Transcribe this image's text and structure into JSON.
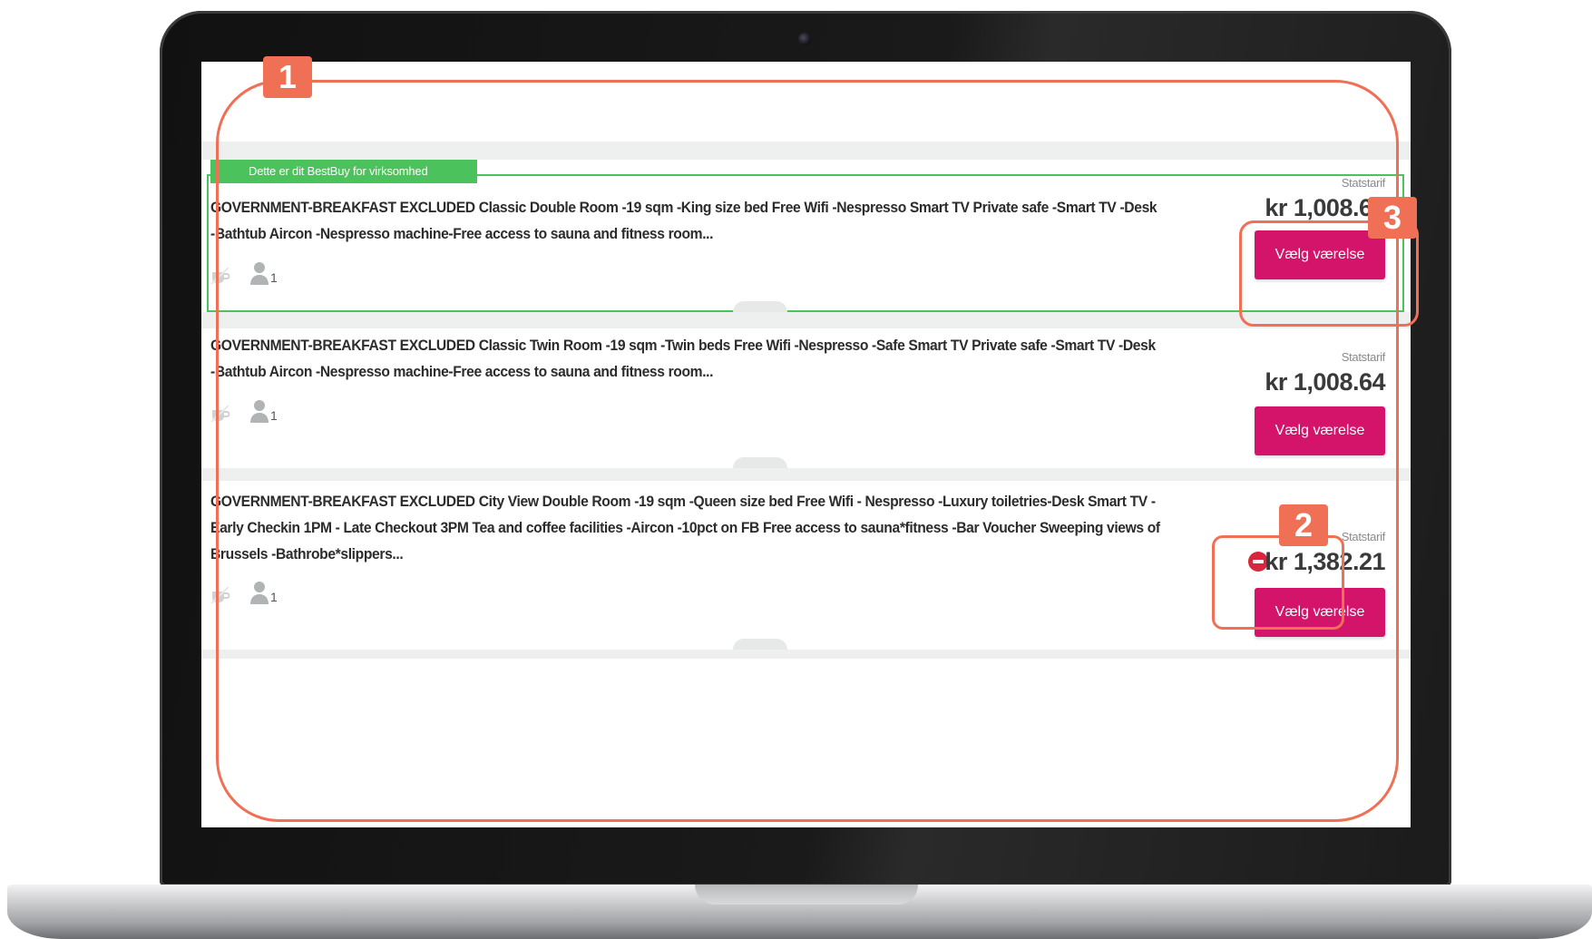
{
  "best_banner": "Dette er dit BestBuy for virksomhed",
  "rooms": [
    {
      "description": "GOVERNMENT-BREAKFAST EXCLUDED Classic Double Room -19 sqm -King size bed Free Wifi -Nespresso Smart TV Private safe -Smart TV -Desk -Bathtub Aircon -Nespresso machine-Free access to sauna and fitness room...",
      "occupancy": "1",
      "rate_label": "Statstarif",
      "price": "kr 1,008.64",
      "button_label": "Vælg værelse"
    },
    {
      "description": "GOVERNMENT-BREAKFAST EXCLUDED Classic Twin Room -19 sqm -Twin beds Free Wifi -Nespresso -Safe Smart TV Private safe -Smart TV -Desk -Bathtub Aircon -Nespresso machine-Free access to sauna and fitness room...",
      "occupancy": "1",
      "rate_label": "Statstarif",
      "price": "kr 1,008.64",
      "button_label": "Vælg værelse"
    },
    {
      "description": "GOVERNMENT-BREAKFAST EXCLUDED City View Double Room -19 sqm -Queen size bed Free Wifi - Nespresso -Luxury toiletries-Desk Smart TV -Early Checkin 1PM - Late Checkout 3PM Tea and coffee facilities -Aircon -10pct on FB Free access to sauna*fitness -Bar Voucher Sweeping views of Brussels -Bathrobe*slippers...",
      "occupancy": "1",
      "rate_label": "Statstarif",
      "price": "kr 1,382.21",
      "button_label": "Vælg værelse"
    }
  ],
  "annotations": {
    "badge_1": "1",
    "badge_2": "2",
    "badge_3": "3",
    "color": "#f07055"
  },
  "colors": {
    "accent_button": "#d3146a",
    "best_green": "#4cc25c",
    "warning_red": "#d7263d"
  }
}
